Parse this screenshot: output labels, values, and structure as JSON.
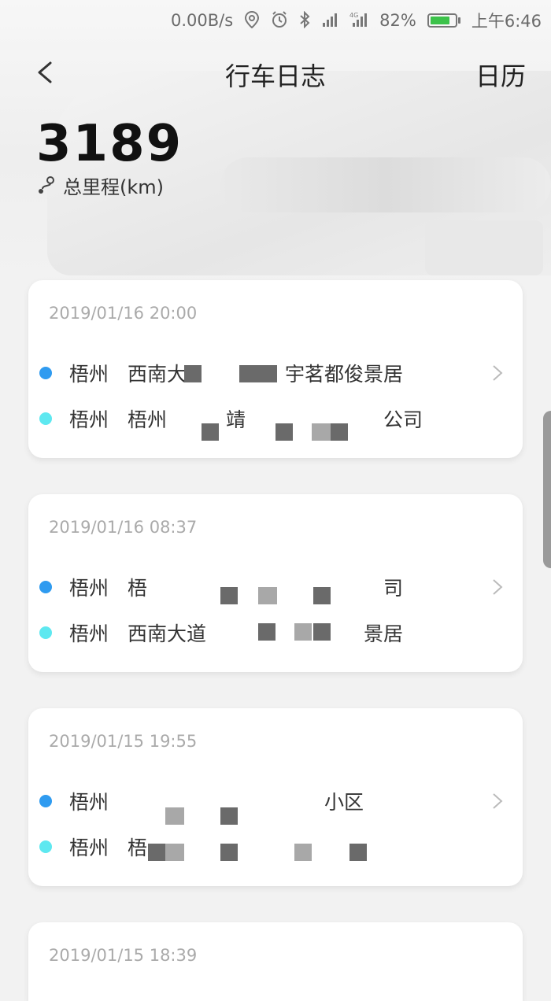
{
  "status_bar": {
    "speed": "0.00B/s",
    "battery": "82%",
    "battery_level": 0.82,
    "time": "上午6:46",
    "icons": [
      "location-icon",
      "alarm-icon",
      "bluetooth-icon",
      "signal-icon",
      "4g-signal-icon",
      "battery-icon"
    ]
  },
  "nav": {
    "title": "行车日志",
    "calendar": "日历"
  },
  "summary": {
    "mileage": "3189",
    "label": "总里程(km)"
  },
  "trips": [
    {
      "time": "2019/01/16 20:00",
      "start_city": "梧州",
      "start_place": "西南大　　　　　宇茗都俊景居",
      "end_city": "梧州",
      "end_place": "梧州　　　靖　　　　　　　公司"
    },
    {
      "time": "2019/01/16 08:37",
      "start_city": "梧州",
      "start_place": "梧　　　　　　　　　　　　司",
      "end_city": "梧州",
      "end_place": "西南大道　　　　　　　　景居"
    },
    {
      "time": "2019/01/15 19:55",
      "start_city": "梧州",
      "start_place": "　　　　　　　　　　小区",
      "end_city": "梧州",
      "end_place": "梧"
    },
    {
      "time": "2019/01/15 18:39"
    }
  ]
}
